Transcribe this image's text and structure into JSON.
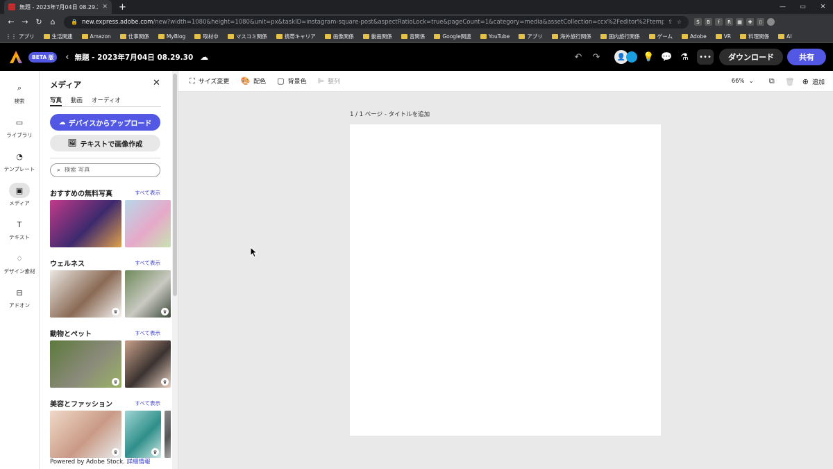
{
  "browser": {
    "tab_title": "無題 - 2023年7月04日 08.29.30",
    "tab_close": "✕",
    "new_tab": "+",
    "win_controls": [
      "—",
      "▭",
      "✕"
    ],
    "url_host": "new.express.adobe.com",
    "url_rest": "/new?width=1080&height=1080&unit=px&taskID=instagram-square-post&aspectRatioLock=true&pageCount=1&category=media&assetCollection=ccx%2Feditor%2Ftemplate%2FInstagram-...",
    "extensions": [
      "S",
      "B",
      "f",
      "R",
      "▦",
      "✚",
      "▯"
    ]
  },
  "bookmarks": [
    "アプリ",
    "生活関連",
    "Amazon",
    "仕事関係",
    "MyBlog",
    "取材中",
    "マスコミ関係",
    "携帯キャリア",
    "画像関係",
    "動画関係",
    "音関係",
    "Google関連",
    "YouTube",
    "アプリ",
    "海外旅行関係",
    "国内旅行関係",
    "ゲーム",
    "Adobe",
    "VR",
    "料理関係",
    "AI"
  ],
  "header": {
    "beta_label": "BETA 版",
    "doc_title": "無題 - 2023年7月04日 08.29.30",
    "download_label": "ダウンロード",
    "share_label": "共有"
  },
  "rail": [
    {
      "label": "検索",
      "icon": "search-icon"
    },
    {
      "label": "ライブラリ",
      "icon": "folder-icon"
    },
    {
      "label": "テンプレート",
      "icon": "template-icon"
    },
    {
      "label": "メディア",
      "icon": "media-icon",
      "active": true
    },
    {
      "label": "テキスト",
      "icon": "text-icon"
    },
    {
      "label": "デザイン素材",
      "icon": "shapes-icon"
    },
    {
      "label": "アドオン",
      "icon": "addons-icon"
    }
  ],
  "panel": {
    "title": "メディア",
    "tabs": [
      "写真",
      "動画",
      "オーディオ"
    ],
    "upload_label": "デバイスからアップロード",
    "generate_label": "テキストで画像作成",
    "search_placeholder": "検索 写真",
    "see_all": "すべて表示",
    "sections": [
      {
        "name": "おすすめの無料写真",
        "thumbs": [
          {
            "colors": [
              "#c23a8a",
              "#3d2a6e",
              "#e0a04a"
            ],
            "w": 103,
            "crown": false
          },
          {
            "colors": [
              "#b8d7e8",
              "#e6a9c9",
              "#c7e3b2"
            ],
            "w": 66,
            "crown": false
          }
        ]
      },
      {
        "name": "ウェルネス",
        "thumbs": [
          {
            "colors": [
              "#eae6e1",
              "#8a6a55",
              "#f5f5f3"
            ],
            "w": 103,
            "crown": true
          },
          {
            "colors": [
              "#6f8a5a",
              "#c9c9c2",
              "#3d4a3a"
            ],
            "w": 66,
            "crown": true
          }
        ]
      },
      {
        "name": "動物とペット",
        "thumbs": [
          {
            "colors": [
              "#5d7a3c",
              "#8a8a7a",
              "#9bb266"
            ],
            "w": 103,
            "crown": true
          },
          {
            "colors": [
              "#c8a08a",
              "#3b3330",
              "#e8d0c0"
            ],
            "w": 66,
            "crown": true
          }
        ]
      },
      {
        "name": "美容とファッション",
        "thumbs": [
          {
            "colors": [
              "#f0d8c8",
              "#c99a85",
              "#e9eef0"
            ],
            "w": 103,
            "crown": true
          },
          {
            "colors": [
              "#9fd4d4",
              "#2f8f8a",
              "#cfe9e6"
            ],
            "w": 52,
            "crown": true
          },
          {
            "colors": [
              "#888",
              "#555",
              "#aaa"
            ],
            "w": 10,
            "crown": false
          }
        ]
      }
    ],
    "powered_by": "Powered by Adobe Stock.",
    "more_info": "詳細情報"
  },
  "editor_toolbar": {
    "resize": "サイズ変更",
    "color": "配色",
    "bg_color": "背景色",
    "align": "整列",
    "zoom": "66%",
    "add": "追加"
  },
  "canvas": {
    "page_label": "1 / 1 ページ - タイトルを追加"
  }
}
